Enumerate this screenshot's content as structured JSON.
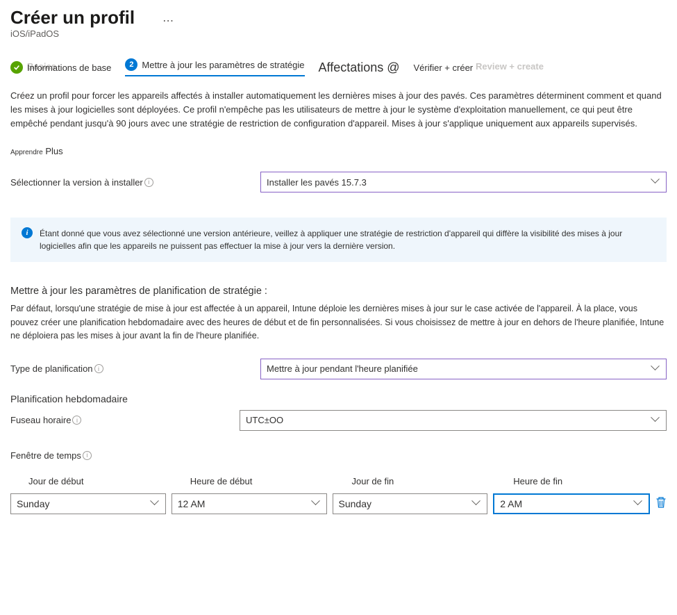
{
  "header": {
    "title": "Créer un profil",
    "subtitle": "iOS/iPadOS"
  },
  "steps": {
    "basics_ghost": "Basics",
    "done": "Informations de base",
    "active": "Mettre à jour les paramètres de stratégie",
    "assignments": "Affectations @",
    "verify": "Vérifier + créer",
    "verify_ghost": "Review + create",
    "active_num": "2"
  },
  "description": "Créez un profil pour forcer les appareils affectés à installer automatiquement les dernières mises à jour des pavés. Ces paramètres déterminent comment et quand les mises à jour logicielles sont déployées. Ce profil n'empêche pas les utilisateurs de mettre à jour le système d'exploitation manuellement, ce qui peut être empêché pendant jusqu'à 90 jours avec une stratégie de restriction de configuration d'appareil. Mises à jour s'applique uniquement aux appareils supervisés.",
  "learn": {
    "small": "Apprendre",
    "big": " Plus"
  },
  "version": {
    "label": "Sélectionner la version à installer",
    "value": "Installer les pavés 15.7.3"
  },
  "info_banner": "Étant donné que vous avez sélectionné une version antérieure, veillez à appliquer une stratégie de restriction d'appareil qui diffère la visibilité des mises à jour logicielles afin que les appareils ne puissent pas effectuer la mise à jour vers la dernière version.",
  "schedule": {
    "heading": "Mettre à jour les paramètres de planification de stratégie :",
    "desc": "Par défaut, lorsqu'une stratégie de mise à jour est affectée à un appareil, Intune déploie les dernières mises à jour sur le case activée de l'appareil. À la place, vous pouvez créer une planification hebdomadaire avec des heures de début et de fin personnalisées. Si vous choisissez de mettre à jour en dehors de l'heure planifiée, Intune ne déploiera pas les mises à jour avant la fin de l'heure planifiée.",
    "type_label": "Type de planification",
    "type_value": "Mettre à jour pendant l'heure planifiée",
    "weekly_label": "Planification hebdomadaire",
    "tz_label": "Fuseau horaire",
    "tz_value": "UTC±OO",
    "window_label": "Fenêtre de temps"
  },
  "timewindow": {
    "headers": {
      "start_day": "Jour de début",
      "start_time": "Heure de début",
      "end_day": "Jour de fin",
      "end_time": "Heure de fin"
    },
    "row": {
      "start_day": "Sunday",
      "start_time": "12 AM",
      "end_day": "Sunday",
      "end_time": "2 AM"
    }
  }
}
